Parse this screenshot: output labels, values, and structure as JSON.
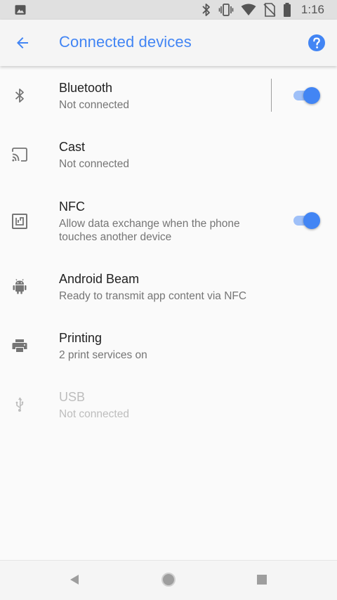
{
  "status_bar": {
    "time": "1:16",
    "icons": [
      "image-icon",
      "bluetooth-icon",
      "vibrate-icon",
      "wifi-icon",
      "no-sim-icon",
      "battery-icon"
    ]
  },
  "app_bar": {
    "title": "Connected devices",
    "back_icon": "arrow-back-icon",
    "help_icon": "help-circle-icon",
    "accent_color": "#4285f4"
  },
  "settings": {
    "items": [
      {
        "id": "bluetooth",
        "icon": "bluetooth-icon",
        "label": "Bluetooth",
        "summary": "Not connected",
        "toggle": true,
        "enabled": true
      },
      {
        "id": "cast",
        "icon": "cast-icon",
        "label": "Cast",
        "summary": "Not connected",
        "enabled": true
      },
      {
        "id": "nfc",
        "icon": "nfc-icon",
        "label": "NFC",
        "summary": "Allow data exchange when the phone touches another device",
        "toggle": true,
        "enabled": true
      },
      {
        "id": "android-beam",
        "icon": "android-icon",
        "label": "Android Beam",
        "summary": "Ready to transmit app content via NFC",
        "enabled": true
      },
      {
        "id": "printing",
        "icon": "printer-icon",
        "label": "Printing",
        "summary": "2 print services on",
        "enabled": true
      },
      {
        "id": "usb",
        "icon": "usb-icon",
        "label": "USB",
        "summary": "Not connected",
        "enabled": false
      }
    ]
  },
  "navigation": {
    "icons": [
      "back-triangle-icon",
      "home-circle-icon",
      "recents-square-icon"
    ]
  }
}
